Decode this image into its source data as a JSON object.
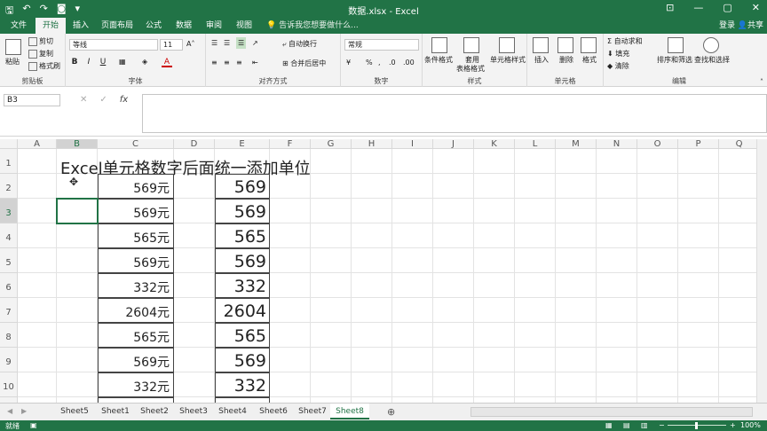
{
  "window": {
    "title": "数据.xlsx - Excel"
  },
  "qat": [
    "save-icon",
    "undo-icon",
    "redo-icon",
    "camera-icon",
    "customize-icon"
  ],
  "tabs": [
    "文件",
    "开始",
    "插入",
    "页面布局",
    "公式",
    "数据",
    "审阅",
    "视图"
  ],
  "tell_me": "告诉我您想要做什么...",
  "signin": "登录",
  "share": "共享",
  "ribbon": {
    "clipboard": {
      "label": "剪贴板",
      "paste": "粘贴",
      "cut": "剪切",
      "copy": "复制",
      "format_painter": "格式刷"
    },
    "font": {
      "label": "字体",
      "name": "等线",
      "size": "11",
      "bold": "B",
      "italic": "I",
      "underline": "U",
      "font_color": "A"
    },
    "align": {
      "label": "对齐方式",
      "wrap": "自动换行",
      "merge": "合并后居中"
    },
    "number": {
      "label": "数字",
      "format": "常规",
      "percent": "%"
    },
    "styles": {
      "label": "样式",
      "conditional": "条件格式",
      "table1": "套用",
      "table2": "表格格式",
      "cell_styles": "单元格样式"
    },
    "cells": {
      "label": "单元格",
      "insert": "插入",
      "delete": "删除",
      "format": "格式"
    },
    "editing": {
      "label": "编辑",
      "autosum": "自动求和",
      "fill": "填充",
      "clear": "清除",
      "sort": "排序和筛选",
      "find": "查找和选择"
    }
  },
  "name_box": "B3",
  "fx": "fx",
  "columns": [
    "A",
    "B",
    "C",
    "D",
    "E",
    "F",
    "G",
    "H",
    "I",
    "J",
    "K",
    "L",
    "M",
    "N",
    "O",
    "P",
    "Q"
  ],
  "rows": [
    "1",
    "2",
    "3",
    "4",
    "5",
    "6",
    "7",
    "8",
    "9",
    "10"
  ],
  "heading": "Excel单元格数字后面统一添加单位",
  "col_c": [
    "569元",
    "569元",
    "565元",
    "569元",
    "332元",
    "2604元",
    "565元",
    "569元",
    "332元"
  ],
  "col_e": [
    "569",
    "569",
    "565",
    "569",
    "332",
    "2604",
    "565",
    "569",
    "332"
  ],
  "sheets": [
    "Sheet5",
    "Sheet1",
    "Sheet2",
    "Sheet3",
    "Sheet4",
    "Sheet6",
    "Sheet7",
    "Sheet8"
  ],
  "active_sheet": "Sheet8",
  "status": "就绪",
  "zoom": "100%",
  "colors": {
    "accent": "#217346"
  }
}
